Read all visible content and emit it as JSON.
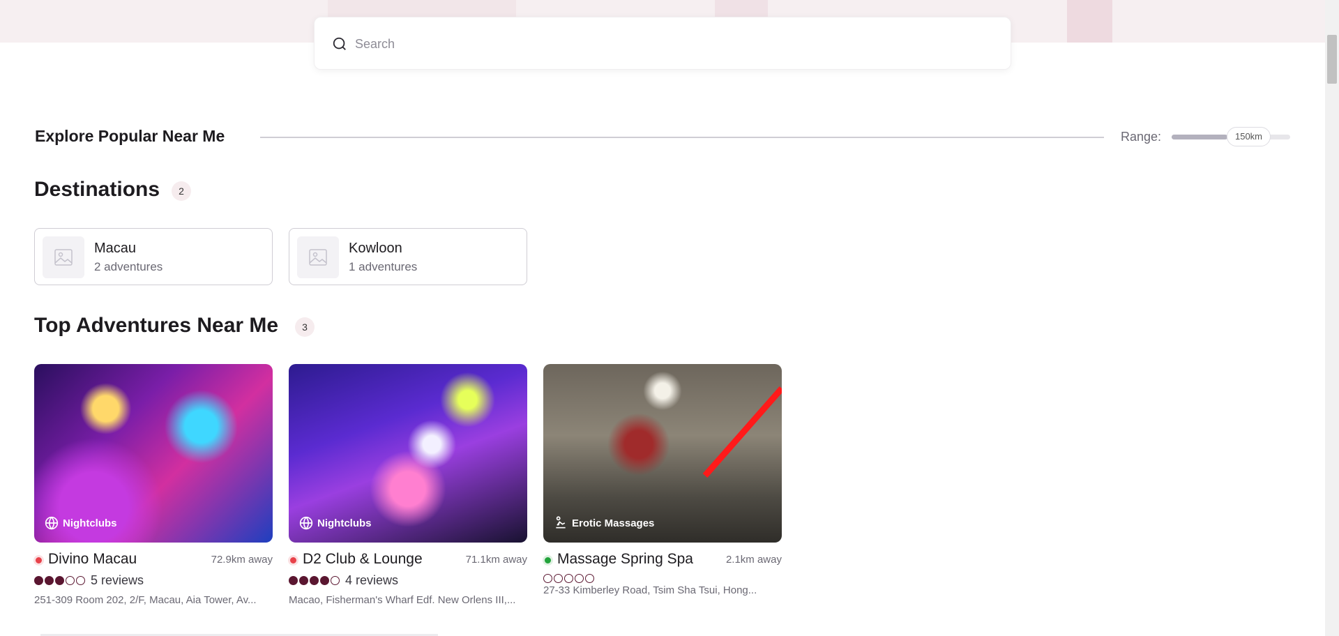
{
  "search": {
    "placeholder": "Search"
  },
  "explore": {
    "title": "Explore Popular Near Me",
    "range_label": "Range:",
    "range_value": "150km",
    "range_fraction": 0.47
  },
  "destinations": {
    "title": "Destinations",
    "count": "2",
    "items": [
      {
        "name": "Macau",
        "subtitle": "2 adventures"
      },
      {
        "name": "Kowloon",
        "subtitle": "1 adventures"
      }
    ]
  },
  "adventures": {
    "title": "Top Adventures Near Me",
    "count": "3",
    "items": [
      {
        "category": "Nightclubs",
        "category_icon": "globe-icon",
        "name": "Divino Macau",
        "status": "closed",
        "status_color": "#e8424a",
        "distance": "72.9km away",
        "rating": 3,
        "reviews": "5 reviews",
        "address": "251-309 Room 202, 2/F, Macau, Aia Tower, Av..."
      },
      {
        "category": "Nightclubs",
        "category_icon": "globe-icon",
        "name": "D2 Club & Lounge",
        "status": "closed",
        "status_color": "#e8424a",
        "distance": "71.1km away",
        "rating": 4,
        "reviews": "4 reviews",
        "address": "Macao, Fisherman's Wharf Edf. New Orlens III,..."
      },
      {
        "category": "Erotic Massages",
        "category_icon": "massage-icon",
        "name": "Massage Spring Spa",
        "status": "open",
        "status_color": "#22a33b",
        "distance": "2.1km away",
        "rating": 0,
        "reviews": "",
        "address": "27-33 Kimberley Road, Tsim Sha Tsui, Hong..."
      }
    ]
  },
  "colors": {
    "accent": "#5a1630",
    "hero_bg": "#f6eff1",
    "badge_bg": "#f6ecee"
  }
}
